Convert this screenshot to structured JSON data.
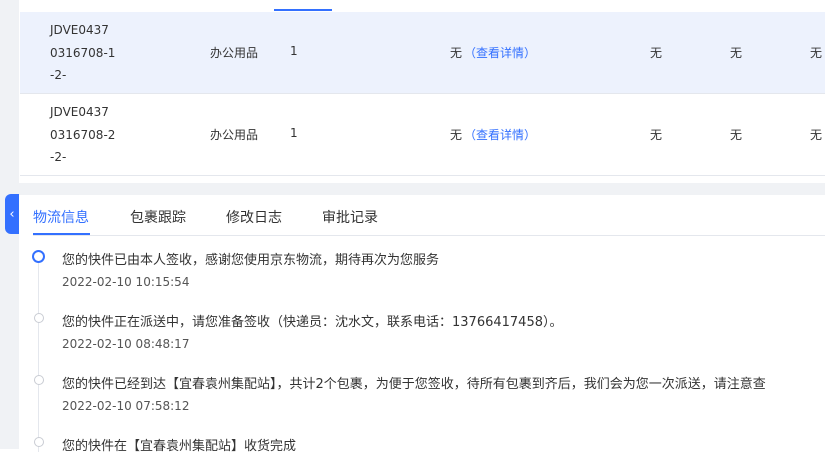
{
  "order_table": {
    "rows": [
      {
        "code": "JDVE0437\n0316708-1\n-2-",
        "category": "办公用品",
        "quantity": "1",
        "remark": "无",
        "detail_link": "（查看详情）",
        "col_a": "无",
        "col_b": "无",
        "col_c": "无"
      },
      {
        "code": "JDVE0437\n0316708-2\n-2-",
        "category": "办公用品",
        "quantity": "1",
        "remark": "无",
        "detail_link": "（查看详情）",
        "col_a": "无",
        "col_b": "无",
        "col_c": "无"
      }
    ]
  },
  "logistics_tabs": {
    "items": [
      {
        "label": "物流信息",
        "active": true
      },
      {
        "label": "包裹跟踪",
        "active": false
      },
      {
        "label": "修改日志",
        "active": false
      },
      {
        "label": "审批记录",
        "active": false
      }
    ]
  },
  "timeline": {
    "events": [
      {
        "text": "您的快件已由本人签收，感谢您使用京东物流，期待再次为您服务",
        "time": "2022-02-10 10:15:54"
      },
      {
        "text": "您的快件正在派送中，请您准备签收（快递员：沈水文，联系电话：13766417458）。",
        "time": "2022-02-10 08:48:17"
      },
      {
        "text": "您的快件已经到达【宜春袁州集配站】，共计2个包裹，为便于您签收，待所有包裹到齐后，我们会为您一次派送，请注意查",
        "time": "2022-02-10 07:58:12"
      },
      {
        "text": "您的快件在【宜春袁州集配站】收货完成",
        "time": ""
      }
    ]
  },
  "icons": {
    "collapse": "chevron-left-icon"
  },
  "colors": {
    "accent": "#3370ff",
    "row_highlight": "#edf2fd",
    "divider_gray": "#f0f2f5"
  }
}
